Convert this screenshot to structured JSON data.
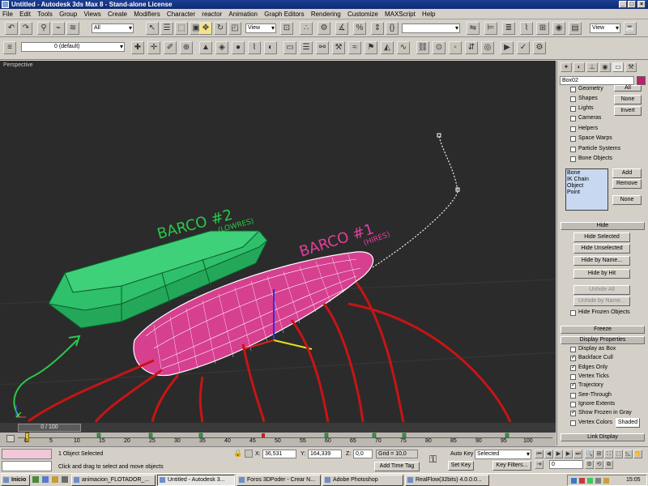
{
  "window": {
    "title": "Untitled - Autodesk 3ds Max 8 - Stand-alone License",
    "min": "_",
    "max": "□",
    "close": "×"
  },
  "menu": [
    "File",
    "Edit",
    "Tools",
    "Group",
    "Views",
    "Create",
    "Modifiers",
    "Character",
    "reactor",
    "Animation",
    "Graph Editors",
    "Rendering",
    "Customize",
    "MAXScript",
    "Help"
  ],
  "toolbar": {
    "selection_filter": "All",
    "ref_coord": "View",
    "named_sel": "",
    "view_right": "View",
    "layer": "0 (default)"
  },
  "viewport": {
    "label": "Perspective",
    "annotation_1": "BARCO #2",
    "annotation_1_sub": "(LOWRES)",
    "annotation_2": "BARCO #1",
    "annotation_2_sub": "(HIRES)"
  },
  "panel": {
    "object_name": "Box02",
    "hide_by_category": [
      "Geometry",
      "Shapes",
      "Lights",
      "Cameras",
      "Helpers",
      "Space Warps",
      "Particle Systems",
      "Bone Objects"
    ],
    "btn_all": "All",
    "btn_none": "None",
    "btn_invert": "Invert",
    "list_items": [
      "Bone",
      "IK Chain Object",
      "Point"
    ],
    "btn_add": "Add",
    "btn_remove": "Remove",
    "btn_none2": "None",
    "hide_header": "Hide",
    "hide_selected": "Hide Selected",
    "hide_unselected": "Hide Unselected",
    "hide_by_name": "Hide by Name...",
    "hide_by_hit": "Hide by Hit",
    "unhide_all": "Unhide All",
    "unhide_by_name": "Unhide by Name...",
    "hide_frozen": "Hide Frozen Objects",
    "freeze_header": "Freeze",
    "display_props_header": "Display Properties",
    "display_props": [
      {
        "label": "Display as Box",
        "checked": false
      },
      {
        "label": "Backface Cull",
        "checked": true
      },
      {
        "label": "Edges Only",
        "checked": true
      },
      {
        "label": "Vertex Ticks",
        "checked": false
      },
      {
        "label": "Trajectory",
        "checked": true
      },
      {
        "label": "See-Through",
        "checked": false
      },
      {
        "label": "Ignore Extents",
        "checked": false
      },
      {
        "label": "Show Frozen in Gray",
        "checked": true
      },
      {
        "label": "Vertex Colors",
        "checked": false
      }
    ],
    "shaded": "Shaded",
    "link_display": "Link Display"
  },
  "timeline": {
    "frame": "0 / 100",
    "ticks": [
      "0",
      "5",
      "10",
      "15",
      "20",
      "25",
      "30",
      "35",
      "40",
      "45",
      "50",
      "55",
      "60",
      "65",
      "70",
      "75",
      "80",
      "85",
      "90",
      "95",
      "100"
    ]
  },
  "status": {
    "selected": "1 Object Selected",
    "prompt": "Click and drag to select and move objects",
    "x_label": "X:",
    "x": "36,531",
    "y_label": "Y:",
    "y": "164,339",
    "z_label": "Z:",
    "z": "0,0",
    "grid": "Grid = 10,0",
    "add_time_tag": "Add Time Tag",
    "auto_key": "Auto Key",
    "set_key": "Set Key",
    "key_mode": "Selected",
    "key_filters": "Key Filters...",
    "current_frame": "0"
  },
  "taskbar": {
    "start": "Inicio",
    "tasks": [
      "animacion_FLOTADOR_...",
      "Untitled - Autodesk 3...",
      "Foros 3DPoder - Crear N...",
      "Adobe Photoshop",
      "RealFlow(32bits) 4.0.0.0..."
    ],
    "clock": "15:05"
  },
  "colors": {
    "viewport_bg": "#2b2b2b",
    "green_boat": "#2ec06a",
    "pink_boat": "#e0409a",
    "annotation_red": "#c81414",
    "annotation_green": "#2ac84a"
  }
}
